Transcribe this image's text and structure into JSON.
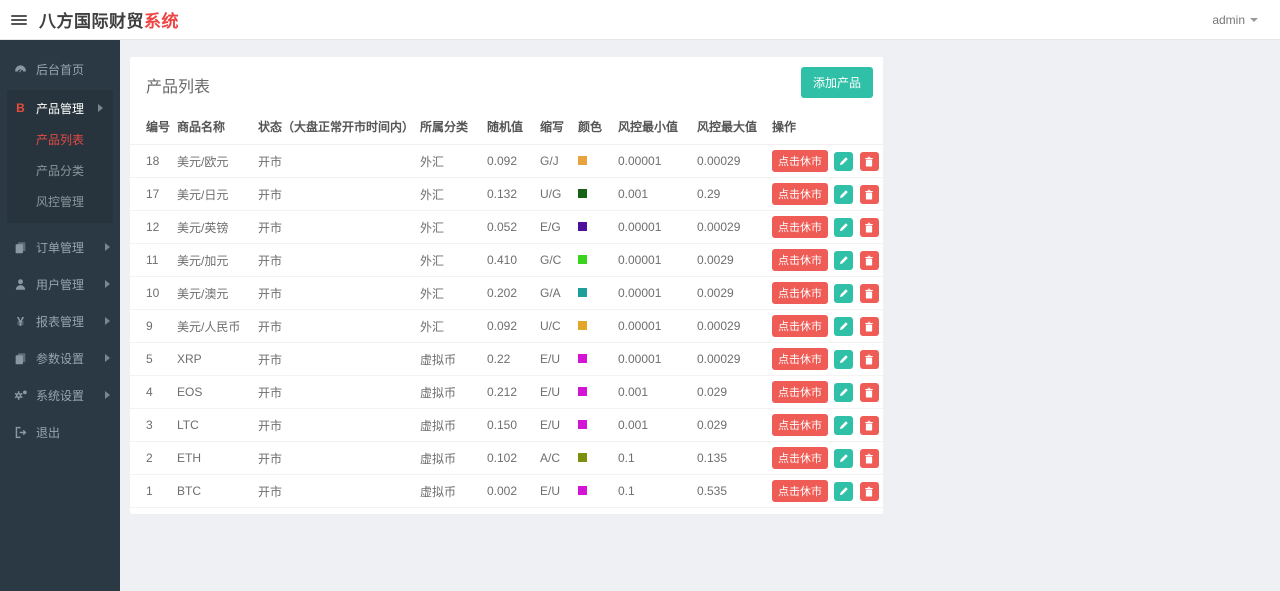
{
  "header": {
    "brand_main": "八方国际财贸",
    "brand_accent": "系统",
    "user": "admin"
  },
  "sidebar": {
    "items": [
      {
        "label": "后台首页",
        "icon": "dashboard-icon"
      },
      {
        "label": "产品管理",
        "icon": "bitcoin-icon",
        "expanded": true,
        "children": [
          {
            "label": "产品列表",
            "active": true
          },
          {
            "label": "产品分类"
          },
          {
            "label": "风控管理"
          }
        ]
      },
      {
        "label": "订单管理",
        "icon": "orders-icon"
      },
      {
        "label": "用户管理",
        "icon": "user-icon"
      },
      {
        "label": "报表管理",
        "icon": "yen-icon"
      },
      {
        "label": "参数设置",
        "icon": "params-icon"
      },
      {
        "label": "系统设置",
        "icon": "gears-icon"
      },
      {
        "label": "退出",
        "icon": "logout-icon"
      }
    ]
  },
  "main": {
    "title": "产品列表",
    "add_button": "添加产品",
    "table": {
      "columns": [
        "编号",
        "商品名称",
        "状态（大盘正常开市时间内）",
        "所属分类",
        "随机值",
        "缩写",
        "颜色",
        "风控最小值",
        "风控最大值",
        "操作"
      ],
      "action_close": "点击休市",
      "rows": [
        {
          "id": "18",
          "name": "美元/欧元",
          "status": "开市",
          "category": "外汇",
          "random": "0.092",
          "abbr": "G/J",
          "color": "#e8a33d",
          "min": "0.00001",
          "max": "0.00029"
        },
        {
          "id": "17",
          "name": "美元/日元",
          "status": "开市",
          "category": "外汇",
          "random": "0.132",
          "abbr": "U/G",
          "color": "#176117",
          "min": "0.001",
          "max": "0.29"
        },
        {
          "id": "12",
          "name": "美元/英镑",
          "status": "开市",
          "category": "外汇",
          "random": "0.052",
          "abbr": "E/G",
          "color": "#4f0f9e",
          "min": "0.00001",
          "max": "0.00029"
        },
        {
          "id": "11",
          "name": "美元/加元",
          "status": "开市",
          "category": "外汇",
          "random": "0.410",
          "abbr": "G/C",
          "color": "#3bd41c",
          "min": "0.00001",
          "max": "0.0029"
        },
        {
          "id": "10",
          "name": "美元/澳元",
          "status": "开市",
          "category": "外汇",
          "random": "0.202",
          "abbr": "G/A",
          "color": "#1d9e96",
          "min": "0.00001",
          "max": "0.0029"
        },
        {
          "id": "9",
          "name": "美元/人民币",
          "status": "开市",
          "category": "外汇",
          "random": "0.092",
          "abbr": "U/C",
          "color": "#e2a62a",
          "min": "0.00001",
          "max": "0.00029"
        },
        {
          "id": "5",
          "name": "XRP",
          "status": "开市",
          "category": "虚拟币",
          "random": "0.22",
          "abbr": "E/U",
          "color": "#d414d4",
          "min": "0.00001",
          "max": "0.00029"
        },
        {
          "id": "4",
          "name": "EOS",
          "status": "开市",
          "category": "虚拟币",
          "random": "0.212",
          "abbr": "E/U",
          "color": "#d414d4",
          "min": "0.001",
          "max": "0.029"
        },
        {
          "id": "3",
          "name": "LTC",
          "status": "开市",
          "category": "虚拟币",
          "random": "0.150",
          "abbr": "E/U",
          "color": "#d414d4",
          "min": "0.001",
          "max": "0.029"
        },
        {
          "id": "2",
          "name": "ETH",
          "status": "开市",
          "category": "虚拟币",
          "random": "0.102",
          "abbr": "A/C",
          "color": "#7e8f0e",
          "min": "0.1",
          "max": "0.135"
        },
        {
          "id": "1",
          "name": "BTC",
          "status": "开市",
          "category": "虚拟币",
          "random": "0.002",
          "abbr": "E/U",
          "color": "#d414d4",
          "min": "0.1",
          "max": "0.535"
        }
      ]
    }
  },
  "colors": {
    "brand_accent": "#ef4444",
    "sidebar_bg": "#2b3945",
    "active_menu_red": "#e64a45",
    "button_teal": "#30c0a8",
    "button_red": "#ee5c55"
  }
}
